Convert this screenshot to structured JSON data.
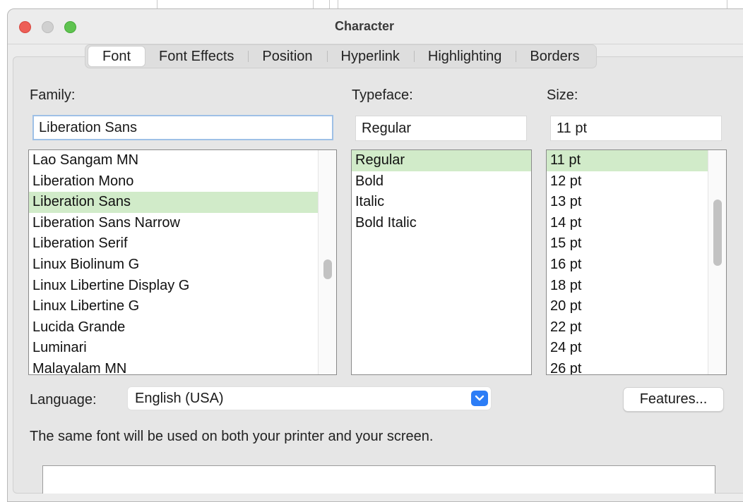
{
  "window": {
    "title": "Character"
  },
  "tabs": [
    {
      "label": "Font",
      "active": true
    },
    {
      "label": "Font Effects",
      "active": false
    },
    {
      "label": "Position",
      "active": false
    },
    {
      "label": "Hyperlink",
      "active": false
    },
    {
      "label": "Highlighting",
      "active": false
    },
    {
      "label": "Borders",
      "active": false
    }
  ],
  "family": {
    "label": "Family:",
    "value": "Liberation Sans",
    "items": [
      "Lao Sangam MN",
      "Liberation Mono",
      "Liberation Sans",
      "Liberation Sans Narrow",
      "Liberation Serif",
      "Linux Biolinum G",
      "Linux Libertine Display G",
      "Linux Libertine G",
      "Lucida Grande",
      "Luminari",
      "Malayalam MN"
    ],
    "selected": "Liberation Sans"
  },
  "typeface": {
    "label": "Typeface:",
    "value": "Regular",
    "items": [
      "Regular",
      "Bold",
      "Italic",
      "Bold Italic"
    ],
    "selected": "Regular"
  },
  "size": {
    "label": "Size:",
    "value": "11 pt",
    "items": [
      "11 pt",
      "12 pt",
      "13 pt",
      "14 pt",
      "15 pt",
      "16 pt",
      "18 pt",
      "20 pt",
      "22 pt",
      "24 pt",
      "26 pt"
    ],
    "selected": "11 pt"
  },
  "language": {
    "label": "Language:",
    "value": "English (USA)"
  },
  "features_button": "Features...",
  "note": "The same font will be used on both your printer and your screen.",
  "icons": {
    "dropdown": "chevron-down-icon"
  },
  "colors": {
    "selection": "#d1ebc9",
    "accent": "#2c7df6",
    "close": "#ed5f57",
    "zoom": "#5fc350"
  }
}
